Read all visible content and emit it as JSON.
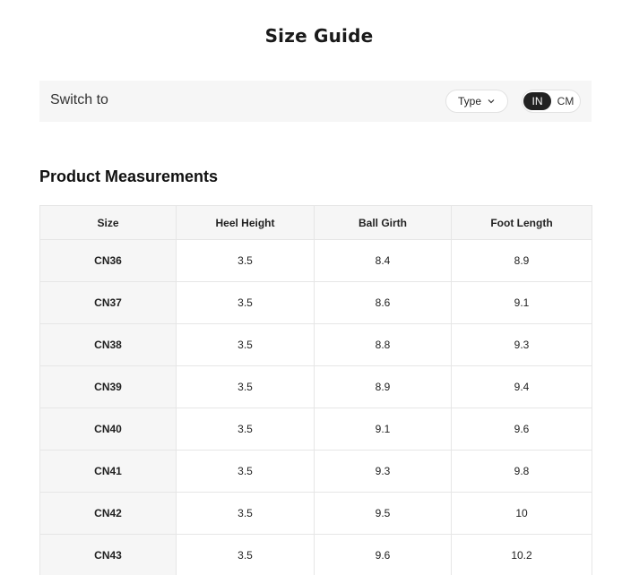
{
  "header": {
    "title": "Size Guide"
  },
  "switch_bar": {
    "label": "Switch to",
    "type_select": {
      "label": "Type",
      "icon": "chevron-down-icon"
    },
    "unit_toggle": {
      "selected": "IN",
      "other": "CM"
    }
  },
  "section": {
    "title": "Product Measurements"
  },
  "table": {
    "columns": [
      "Size",
      "Heel Height",
      "Ball Girth",
      "Foot Length"
    ],
    "rows": [
      [
        "CN36",
        "3.5",
        "8.4",
        "8.9"
      ],
      [
        "CN37",
        "3.5",
        "8.6",
        "9.1"
      ],
      [
        "CN38",
        "3.5",
        "8.8",
        "9.3"
      ],
      [
        "CN39",
        "3.5",
        "8.9",
        "9.4"
      ],
      [
        "CN40",
        "3.5",
        "9.1",
        "9.6"
      ],
      [
        "CN41",
        "3.5",
        "9.3",
        "9.8"
      ],
      [
        "CN42",
        "3.5",
        "9.5",
        "10"
      ],
      [
        "CN43",
        "3.5",
        "9.6",
        "10.2"
      ]
    ]
  },
  "colors": {
    "bar_background": "#f6f6f6",
    "toggle_active": "#222222",
    "border": "#e6e6e6"
  }
}
